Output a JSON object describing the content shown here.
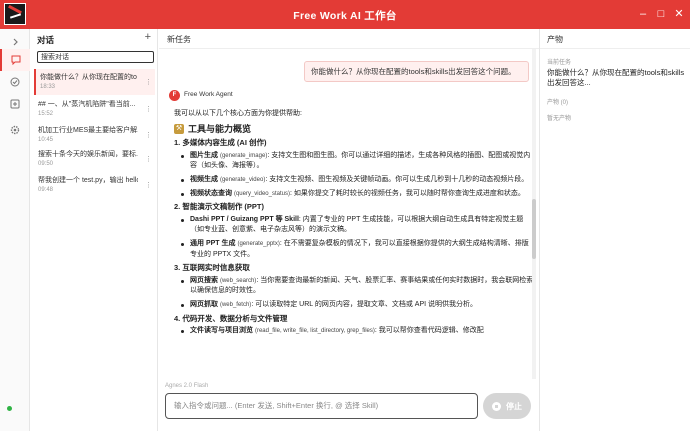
{
  "window": {
    "title": "Free Work  AI 工作台"
  },
  "sidebar": {
    "heading": "对话",
    "add_label": "+",
    "search_value": "搜索对话",
    "conversations": [
      {
        "title": "你能做什么？从你现在配置的to",
        "time": "18:33"
      },
      {
        "title": "## 一、从\"蒸汽机陷阱\"看当前...",
        "time": "15:52"
      },
      {
        "title": "机加工行业MES最主要给客户解...",
        "time": "10:45"
      },
      {
        "title": "搜索十条今天的娱乐新闻，要标...",
        "time": "09:50"
      },
      {
        "title": "帮我创建一个 test.py，输出 hello",
        "time": "09:48"
      }
    ]
  },
  "main": {
    "header": "新任务",
    "user_message": "你能做什么？从你现在配置的tools和skills出发回答这个问题。",
    "agent_name": "Free Work Agent",
    "agent_initial": "F",
    "intro": "我可以从以下几个核心方面为你提供帮助:",
    "h_tools": "工具与能力概览",
    "s1": "1. 多媒体内容生成 (AI 创作)",
    "i1a_b": "图片生成",
    "i1a_c": "(generate_image)",
    "i1a_t": ": 支持文生图和图生图。你可以通过详细的描述，生成各种风格的插图、配图或视觉内容（如头像、海报等）。",
    "i1b_b": "视频生成",
    "i1b_c": "(generate_video)",
    "i1b_t": ": 支持文生视频、图生视频及关键帧动画。你可以生成几秒到十几秒的动态视频片段。",
    "i1c_b": "视频状态查询",
    "i1c_c": "(query_video_status)",
    "i1c_t": ": 如果你提交了耗时较长的视频任务，我可以随时帮你查询生成进度和状态。",
    "s2": "2. 智能演示文稿制作 (PPT)",
    "i2a_b": "Dashi PPT / Guizang PPT 等 Skill",
    "i2a_t": ": 内置了专业的 PPT 生成技能，可以根据大纲自动生成具有特定视觉主题（如专业蓝、创意紫、电子杂志风等）的演示文稿。",
    "i2b_b": "通用 PPT 生成",
    "i2b_c": "(generate_pptx)",
    "i2b_t": ": 在不需要复杂模板的情况下，我可以直接根据你提供的大纲生成结构清晰、排版专业的 PPTX 文件。",
    "s3": "3. 互联网实时信息获取",
    "i3a_b": "网页搜索",
    "i3a_c": "(web_search)",
    "i3a_t": ": 当你需要查询最新的新闻、天气、股票汇率、赛事结果或任何实时数据时，我会联网检索以确保信息的时效性。",
    "i3b_b": "网页抓取",
    "i3b_c": "(web_fetch)",
    "i3b_t": ": 可以读取特定 URL 的网页内容，提取文章、文档或 API 说明供我分析。",
    "s4": "4. 代码开发、数据分析与文件管理",
    "i4a_b": "文件读写与项目浏览",
    "i4a_c": "(read_file, write_file, list_directory, grep_files)",
    "i4a_t": ": 我可以帮你查看代码逻辑、修改配",
    "model_label": "Agnes 2.0 Flash",
    "input_placeholder": "输入指令或问题... (Enter 发送, Shift+Enter 换行, @ 选择 Skill)",
    "stop_label": "停止"
  },
  "artifacts": {
    "header": "产物",
    "current_task_label": "当前任务",
    "current_task": "你能做什么？从你现在配置的tools和skills出发回答这...",
    "count_label": "产物 (0)",
    "empty": "暂无产物"
  },
  "colors": {
    "accent": "#e33b36"
  }
}
